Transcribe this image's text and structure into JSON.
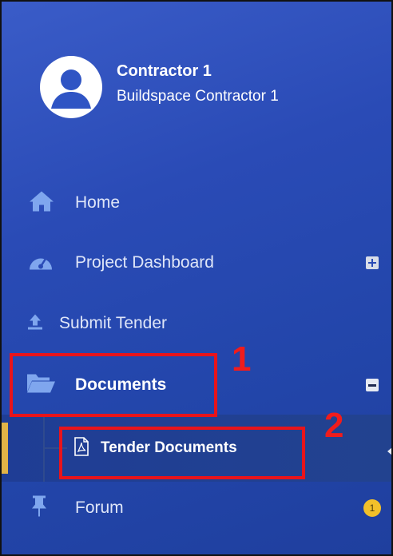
{
  "profile": {
    "name": "Contractor 1",
    "subtitle": "Buildspace Contractor 1"
  },
  "menu": {
    "home": {
      "label": "Home",
      "icon": "home-icon"
    },
    "project_dashboard": {
      "label": "Project Dashboard",
      "icon": "dashboard-icon",
      "expander": "plus"
    },
    "submit_tender": {
      "label": "Submit Tender",
      "icon": "upload-icon"
    },
    "documents": {
      "label": "Documents",
      "icon": "folder-open-icon",
      "expander": "minus"
    },
    "tender_documents": {
      "label": "Tender Documents",
      "icon": "pdf-file-icon"
    },
    "forum": {
      "label": "Forum",
      "icon": "pin-icon",
      "badge": "1"
    }
  },
  "annotations": {
    "step1": "1",
    "step2": "2"
  },
  "colors": {
    "sidebar_top": "#3a5cc8",
    "sidebar_bottom": "#1f3f9e",
    "accent_bar": "#e2b447",
    "highlight_box": "#e8141b",
    "badge": "#f2c02a"
  }
}
